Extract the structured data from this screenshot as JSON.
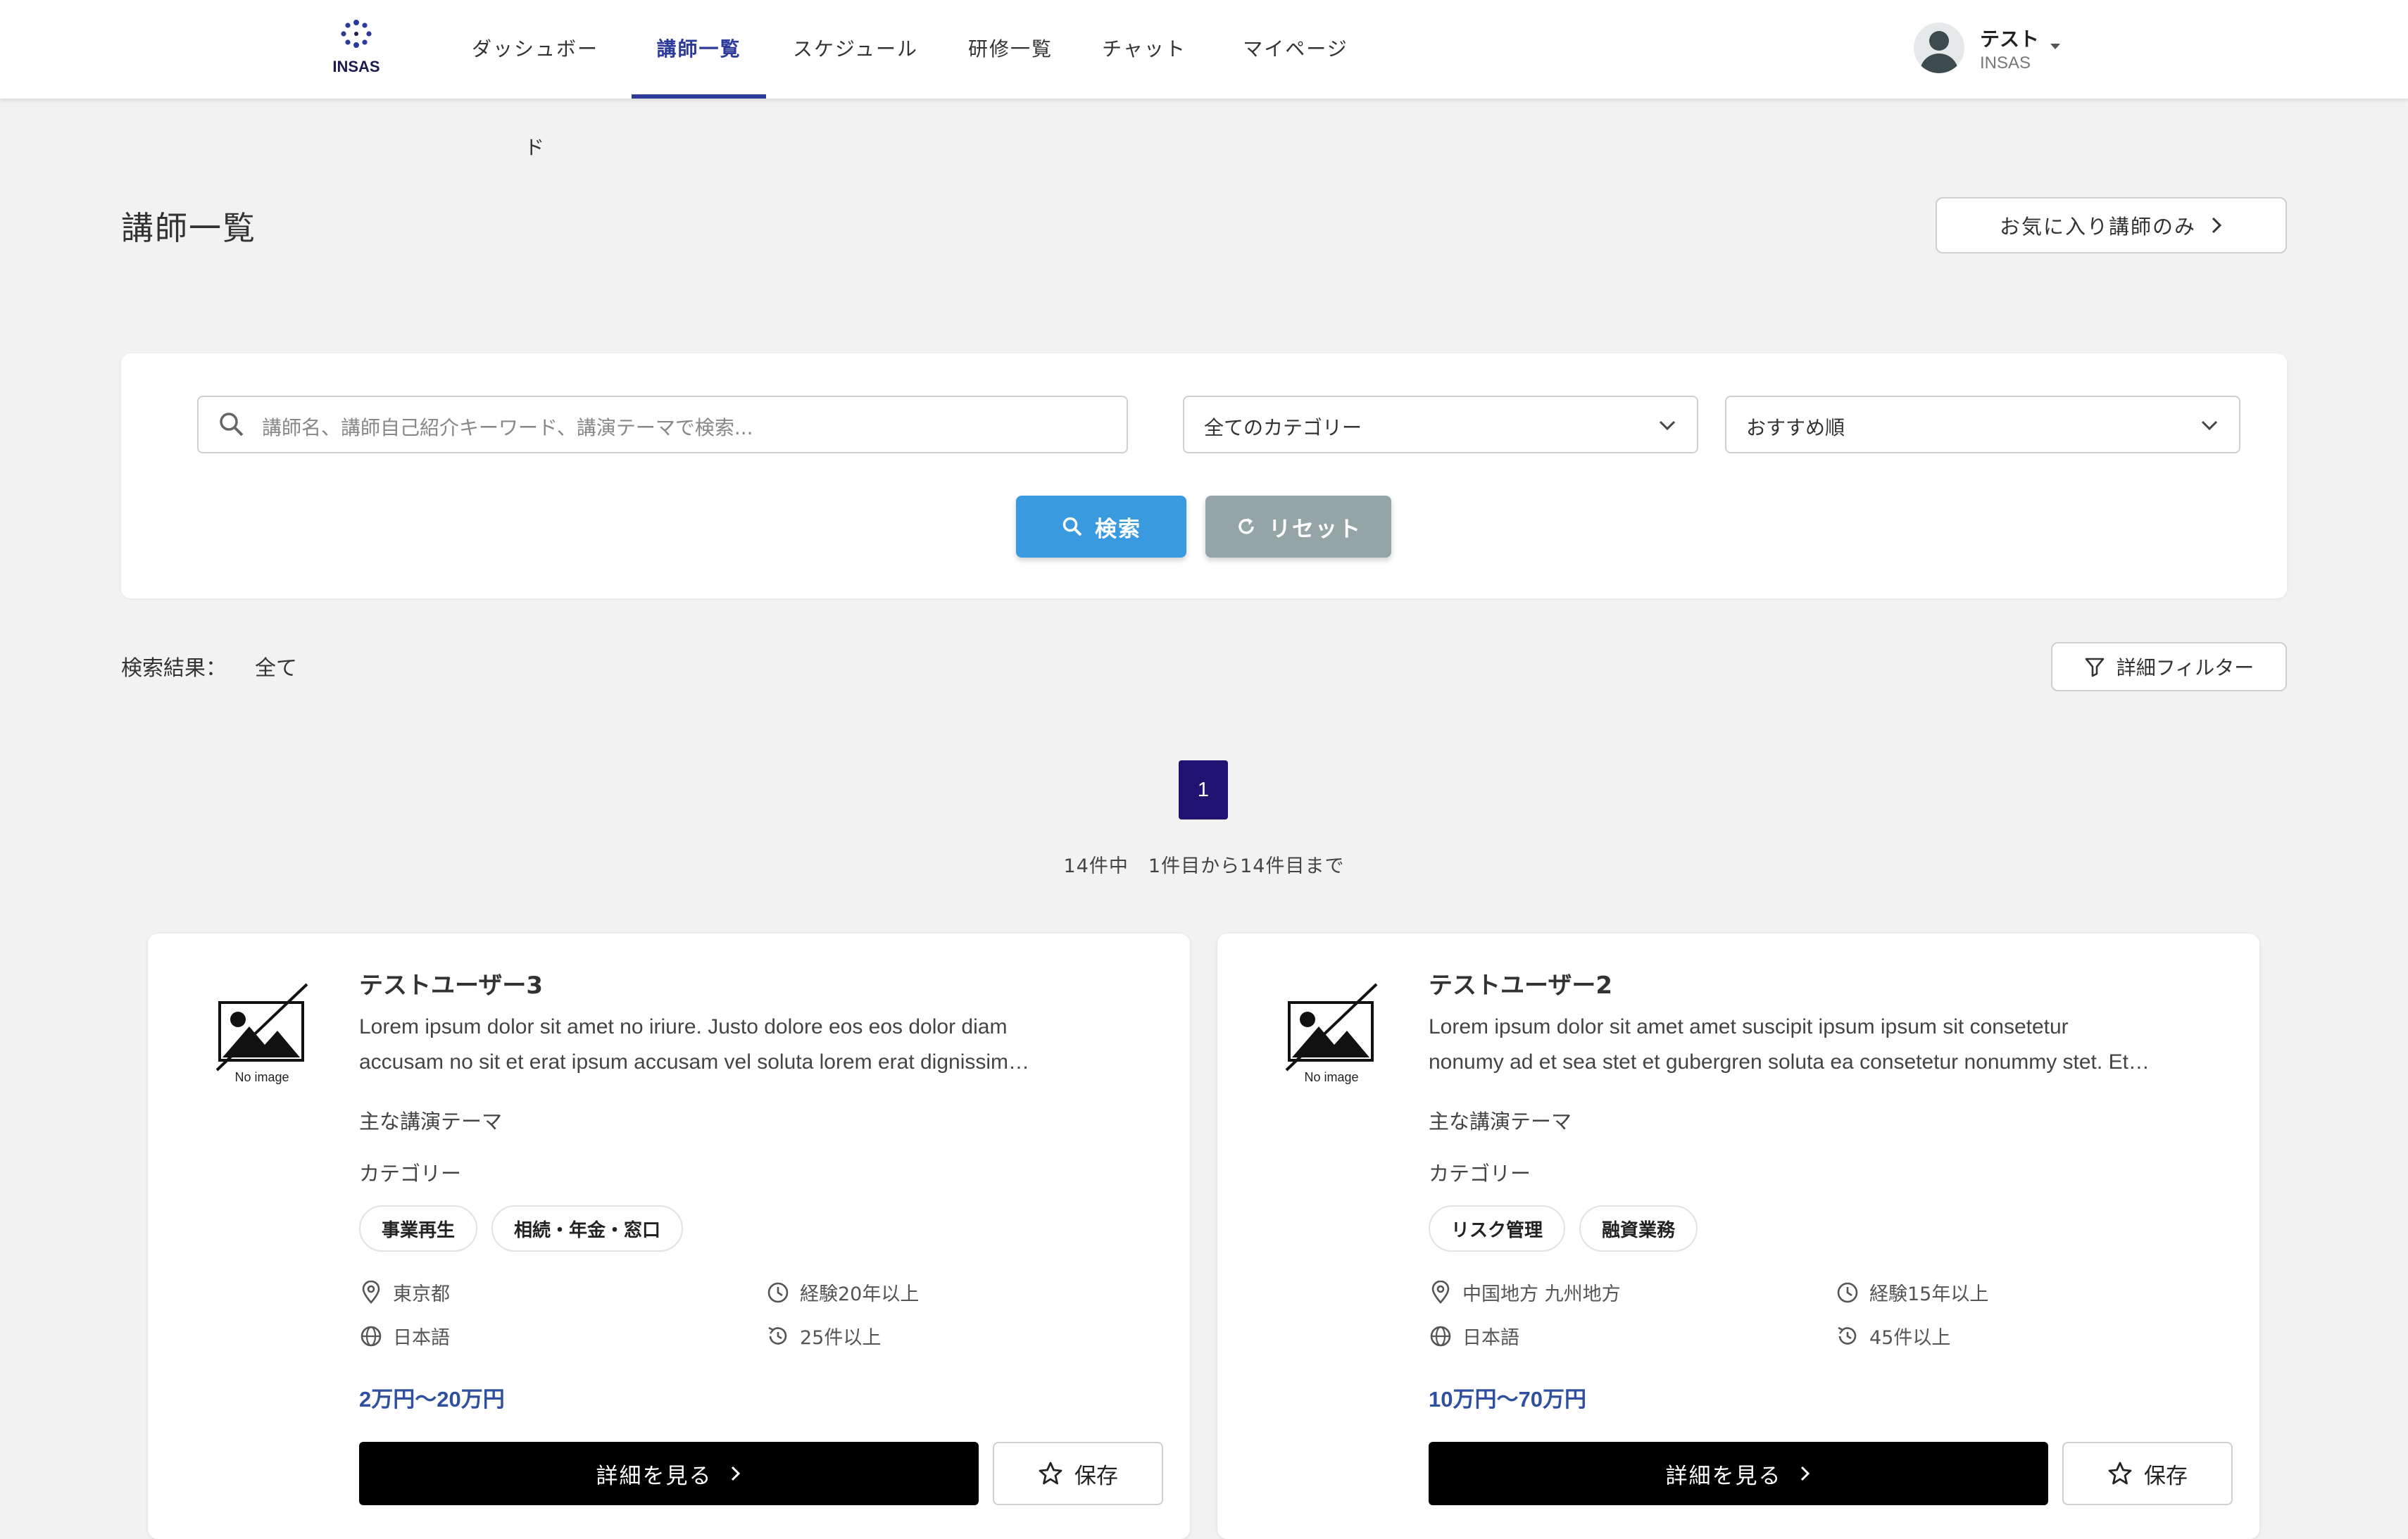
{
  "header": {
    "logo_text": "INSAS",
    "nav": [
      {
        "label": "ダッシュボード"
      },
      {
        "label": "講師一覧"
      },
      {
        "label": "スケジュール"
      },
      {
        "label": "研修一覧"
      },
      {
        "label": "チャット"
      },
      {
        "label": "マイページ"
      }
    ],
    "active_nav": "講師一覧",
    "user": {
      "name": "テスト",
      "org": "INSAS"
    }
  },
  "page": {
    "title": "講師一覧",
    "favorites_button": "お気に入り講師のみ"
  },
  "search": {
    "placeholder": "講師名、講師自己紹介キーワード、講演テーマで検索...",
    "category_select": "全てのカテゴリー",
    "sort_select": "おすすめ順",
    "search_button": "検索",
    "reset_button": "リセット"
  },
  "results": {
    "label": "検索結果：",
    "value": "全て",
    "detail_filter_button": "詳細フィルター"
  },
  "pagination": {
    "current_page": "1",
    "info": "14件中　1件目から14件目まで"
  },
  "cards": [
    {
      "no_image_label": "No image",
      "name": "テストユーザー3",
      "desc_line1": "Lorem ipsum dolor sit amet no iriure. Justo dolore eos eos dolor diam",
      "desc_line2": "accusam no sit et erat ipsum accusam vel soluta lorem erat dignissim…",
      "theme_label": "主な講演テーマ",
      "category_label": "カテゴリー",
      "tags": [
        "事業再生",
        "相続・年金・窓口"
      ],
      "location": "東京都",
      "experience": "経験20年以上",
      "language": "日本語",
      "count": "25件以上",
      "price": "2万円〜20万円",
      "detail_button": "詳細を見る",
      "save_button": "保存"
    },
    {
      "no_image_label": "No image",
      "name": "テストユーザー2",
      "desc_line1": "Lorem ipsum dolor sit amet amet suscipit ipsum ipsum sit consetetur",
      "desc_line2": "nonumy ad et sea stet et gubergren soluta ea consetetur nonummy stet. Et…",
      "theme_label": "主な講演テーマ",
      "category_label": "カテゴリー",
      "tags": [
        "リスク管理",
        "融資業務"
      ],
      "location": "中国地方 九州地方",
      "experience": "経験15年以上",
      "language": "日本語",
      "count": "45件以上",
      "price": "10万円〜70万円",
      "detail_button": "詳細を見る",
      "save_button": "保存"
    }
  ],
  "colors": {
    "accent_nav": "#2c3a9a",
    "search_button": "#3a9ae0",
    "reset_button": "#95a5a6",
    "page_active": "#1f1270",
    "price": "#2f4fa0"
  }
}
